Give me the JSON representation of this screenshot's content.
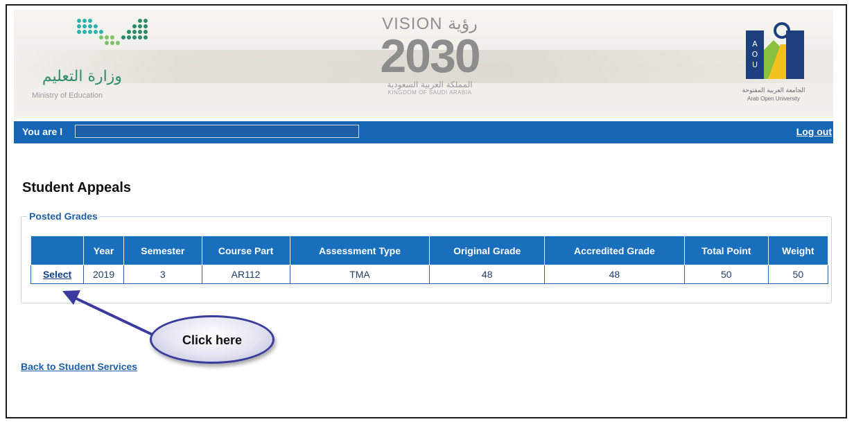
{
  "header": {
    "moe_arabic": "وزارة التعليم",
    "moe_english": "Ministry of Education",
    "vision_top": "VISION رؤية",
    "vision_year": "2030",
    "vision_arabic": "المملكة العربية السعودية",
    "vision_english": "KINGDOM OF SAUDI ARABIA",
    "aou_arabic": "الجامعة العربية المفتوحة",
    "aou_english": "Arab Open University",
    "aou_letters": "AOU"
  },
  "bar": {
    "greeting": "You are l",
    "logout": "Log out"
  },
  "page_title": "Student Appeals",
  "posted_grades": {
    "legend": "Posted Grades",
    "columns": [
      "",
      "Year",
      "Semester",
      "Course Part",
      "Assessment Type",
      "Original Grade",
      "Accredited Grade",
      "Total Point",
      "Weight"
    ],
    "rows": [
      [
        "Select",
        "2019",
        "3",
        "AR112",
        "TMA",
        "48",
        "48",
        "50",
        "50"
      ]
    ]
  },
  "callout": {
    "text": "Click here"
  },
  "back_link": "Back to Student Services",
  "colors": {
    "bar_blue": "#1566b5",
    "header_blue": "#1a6fbd",
    "link_blue": "#1f5fa5",
    "callout_border": "#3a3c9c"
  }
}
